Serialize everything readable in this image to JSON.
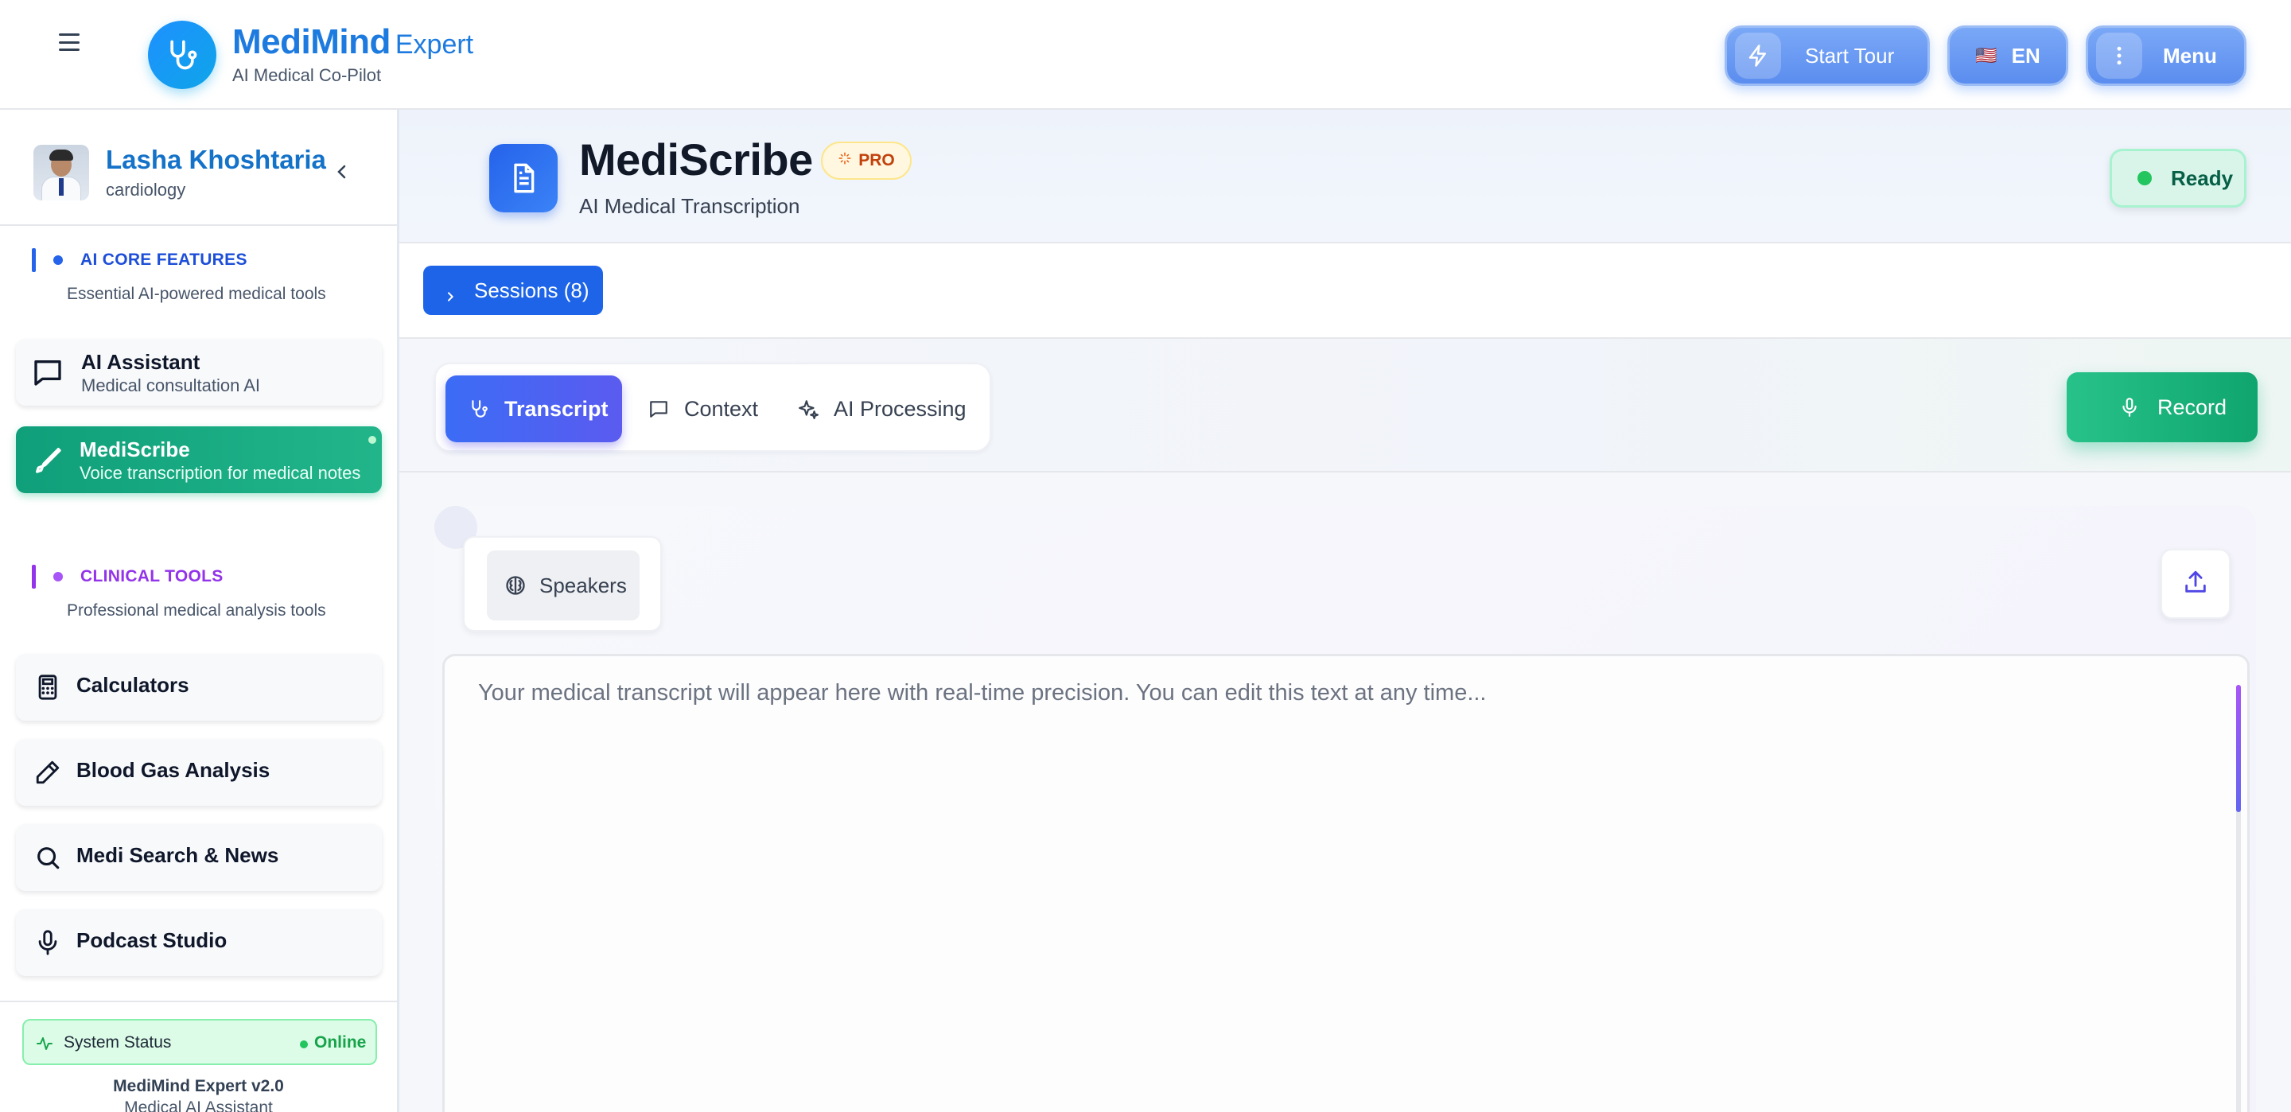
{
  "header": {
    "brand_name": "MediMind",
    "brand_suffix": "Expert",
    "brand_tagline": "AI Medical Co-Pilot",
    "start_tour_label": "Start Tour",
    "lang_flag": "🇺🇸",
    "lang_label": "EN",
    "menu_label": "Menu"
  },
  "sidebar": {
    "user": {
      "name": "Lasha Khoshtaria",
      "specialty": "cardiology"
    },
    "sections": [
      {
        "title": "AI CORE FEATURES",
        "subtitle": "Essential AI-powered medical tools",
        "accent": "#2563eb",
        "items": [
          {
            "title": "AI Assistant",
            "subtitle": "Medical consultation AI",
            "icon": "chat-icon",
            "active": false
          },
          {
            "title": "MediScribe",
            "subtitle": "Voice transcription for medical notes",
            "icon": "stethoscope-icon",
            "active": true
          }
        ]
      },
      {
        "title": "CLINICAL TOOLS",
        "subtitle": "Professional medical analysis tools",
        "accent": "#9333ea",
        "items": [
          {
            "title": "Calculators",
            "icon": "calculator-icon"
          },
          {
            "title": "Blood Gas Analysis",
            "icon": "pen-icon"
          },
          {
            "title": "Medi Search & News",
            "icon": "search-icon"
          },
          {
            "title": "Podcast Studio",
            "icon": "mic-icon"
          }
        ]
      }
    ],
    "system_status": {
      "label": "System Status",
      "status": "Online"
    },
    "version": "MediMind Expert v2.0",
    "version_sub": "Medical AI Assistant"
  },
  "main": {
    "title": "MediScribe",
    "badge": "PRO",
    "subtitle": "AI Medical Transcription",
    "status": "Ready",
    "sessions_label": "Sessions (8)",
    "tabs": [
      {
        "label": "Transcript",
        "icon": "stethoscope-icon",
        "active": true
      },
      {
        "label": "Context",
        "icon": "chat-icon",
        "active": false
      },
      {
        "label": "AI Processing",
        "icon": "sparkles-icon",
        "active": false
      }
    ],
    "record_label": "Record",
    "speakers_label": "Speakers",
    "transcript_placeholder": "Your medical transcript will appear here with real-time precision. You can edit this text at any time..."
  },
  "colors": {
    "brand": "#1d7be0",
    "active_nav": "#10b981",
    "primary": "#1d64e8",
    "record": "#10a56f",
    "ready": "#22c55e"
  }
}
